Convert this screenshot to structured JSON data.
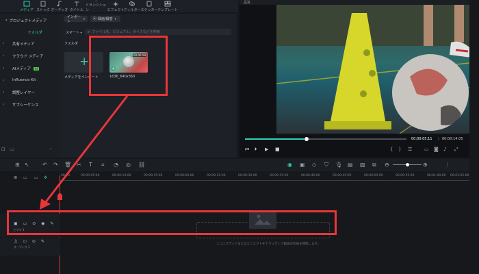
{
  "toolbar": {
    "items": [
      {
        "label": "メディア",
        "icon": "media-icon",
        "active": true
      },
      {
        "label": "ストック",
        "icon": "stock-icon"
      },
      {
        "label": "オーディオ",
        "icon": "audio-icon"
      },
      {
        "label": "タイトル",
        "icon": "title-icon"
      },
      {
        "label": "トランジション",
        "icon": "transition-icon"
      },
      {
        "label": "エフェクト",
        "icon": "effect-icon"
      },
      {
        "label": "フィルター",
        "icon": "filter-icon"
      },
      {
        "label": "ステッカー",
        "icon": "sticker-icon"
      },
      {
        "label": "テンプレート",
        "icon": "template-icon"
      }
    ]
  },
  "sidebar": {
    "items": [
      {
        "label": "プロジェクトメディア",
        "expanded": true
      },
      {
        "label": "フォルダ",
        "selected": true
      },
      {
        "label": "共有メディア"
      },
      {
        "label": "クラウド メディア"
      },
      {
        "label": "AIメディア",
        "badge": "AI"
      },
      {
        "label": "Influence Kit"
      },
      {
        "label": "調整レイヤー"
      },
      {
        "label": "サブシーケンス"
      }
    ]
  },
  "media": {
    "import_label": "インポート",
    "record_label": "録画/録音",
    "smart_label": "スマート",
    "search_placeholder": "ファイル名、ビジュアル、ボイスなどを検索",
    "folder_label": "フォルダ",
    "import_tile_label": "メディアをインポート",
    "clip": {
      "duration": "00:00:58",
      "filename": "1636_640x360"
    }
  },
  "player": {
    "current_time": "00:00:05:11",
    "total_time": "00:00:14:05",
    "progress": 0.34,
    "top_label": "品質"
  },
  "timeline": {
    "ruler_labels": [
      "00:00",
      "00:00:05:00",
      "00:00:10:00",
      "00:00:15:00",
      "00:00:20:00",
      "00:00:25:00",
      "00:00:30:00",
      "00:00:35:00",
      "00:00:40:00",
      "00:00:45:00",
      "00:00:50:00",
      "00:00:55:00",
      "00:01:00:00",
      "00:01:05:00"
    ],
    "video_track": "ビデオ 1",
    "audio_track": "オーディオ 1",
    "drop_hint": "ここにメディアまたはエフェクトをドラッグして動画の作成を開始します。"
  },
  "colors": {
    "accent": "#2ed1b5",
    "annotation": "#e8363a"
  }
}
